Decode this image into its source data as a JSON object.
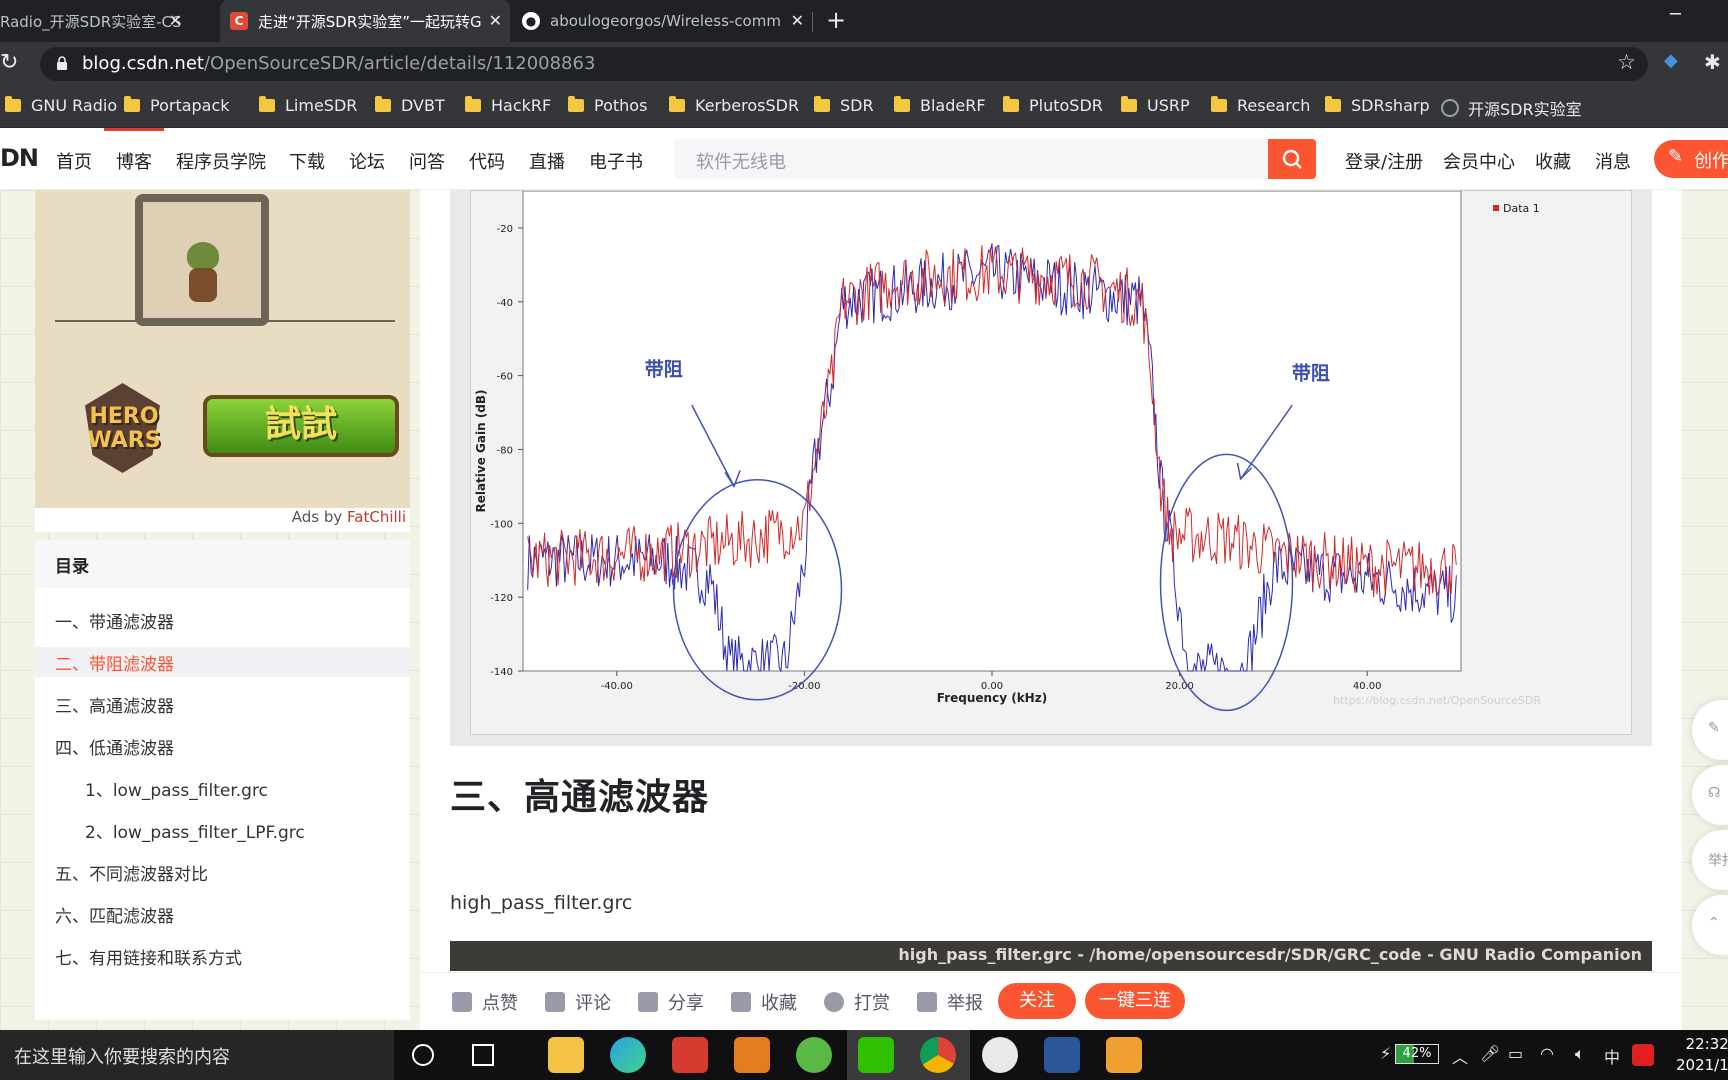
{
  "browser": {
    "tabs": [
      {
        "title": "Radio_开源SDR实验室-CS",
        "active": false,
        "favicon": "csdn-favicon"
      },
      {
        "title": "走进“开源SDR实验室”一起玩转G",
        "active": true,
        "favicon": "csdn-favicon"
      },
      {
        "title": "aboulogeorgos/Wireless-comm",
        "active": false,
        "favicon": "github-favicon"
      }
    ],
    "close_glyph": "✕",
    "new_tab_glyph": "+",
    "minimize_glyph": "─",
    "url_domain": "blog.csdn.net",
    "url_path": "/OpenSourceSDR/article/details/112008863",
    "bookmarks": [
      {
        "label": "GNU Radio",
        "icon": "folder-icon"
      },
      {
        "label": "Portapack",
        "icon": "folder-icon"
      },
      {
        "label": "LimeSDR",
        "icon": "folder-icon"
      },
      {
        "label": "DVBT",
        "icon": "folder-icon"
      },
      {
        "label": "HackRF",
        "icon": "folder-icon"
      },
      {
        "label": "Pothos",
        "icon": "folder-icon"
      },
      {
        "label": "KerberosSDR",
        "icon": "folder-icon"
      },
      {
        "label": "SDR",
        "icon": "folder-icon"
      },
      {
        "label": "BladeRF",
        "icon": "folder-icon"
      },
      {
        "label": "PlutoSDR",
        "icon": "folder-icon"
      },
      {
        "label": "USRP",
        "icon": "folder-icon"
      },
      {
        "label": "Research",
        "icon": "folder-icon"
      },
      {
        "label": "SDRsharp",
        "icon": "folder-icon"
      },
      {
        "label": "开源SDR实验室",
        "icon": "globe-icon"
      }
    ]
  },
  "csdn": {
    "logo": "DN",
    "nav": [
      "首页",
      "博客",
      "程序员学院",
      "下载",
      "论坛",
      "问答",
      "代码",
      "直播",
      "电子书"
    ],
    "search_placeholder": "软件无线电",
    "right_nav": [
      "登录/注册",
      "会员中心",
      "收藏",
      "消息"
    ],
    "create_label": "创作"
  },
  "ad": {
    "hero_text_1": "HERO",
    "hero_text_2": "WARS",
    "button_text": "試試",
    "ads_by": "Ads by ",
    "ads_brand": "FatChilli"
  },
  "toc": {
    "title": "目录",
    "items": [
      {
        "label": "一、带通滤波器",
        "level": 1,
        "active": false
      },
      {
        "label": "二、带阻滤波器",
        "level": 1,
        "active": true
      },
      {
        "label": "三、高通滤波器",
        "level": 1,
        "active": false
      },
      {
        "label": "四、低通滤波器",
        "level": 1,
        "active": false
      },
      {
        "label": "1、low_pass_filter.grc",
        "level": 2,
        "active": false
      },
      {
        "label": "2、low_pass_filter_LPF.grc",
        "level": 2,
        "active": false
      },
      {
        "label": "五、不同滤波器对比",
        "level": 1,
        "active": false
      },
      {
        "label": "六、匹配滤波器",
        "level": 1,
        "active": false
      },
      {
        "label": "七、有用链接和联系方式",
        "level": 1,
        "active": false
      }
    ]
  },
  "chart_data": {
    "type": "line",
    "title": "",
    "xlabel": "Frequency (kHz)",
    "ylabel": "Relative Gain (dB)",
    "xlim": [
      -50,
      50
    ],
    "ylim": [
      -140,
      -10
    ],
    "xticks": [
      -40,
      -20,
      0,
      20,
      40
    ],
    "xtick_labels": [
      "-40.00",
      "-20.00",
      "0.00",
      "20.00",
      "40.00"
    ],
    "yticks": [
      -20,
      -40,
      -60,
      -80,
      -100,
      -120,
      -140
    ],
    "legend": {
      "entries": [
        "Data 1"
      ],
      "position": "top-right"
    },
    "series": [
      {
        "name": "Data 1",
        "color": "#d12a2a",
        "envelope": [
          [
            -50,
            -110
          ],
          [
            -35,
            -108
          ],
          [
            -30,
            -106
          ],
          [
            -25,
            -104
          ],
          [
            -20,
            -100
          ],
          [
            -19,
            -85
          ],
          [
            -17,
            -60
          ],
          [
            -16,
            -40
          ],
          [
            -10,
            -34
          ],
          [
            0,
            -32
          ],
          [
            10,
            -34
          ],
          [
            16,
            -40
          ],
          [
            17,
            -60
          ],
          [
            18,
            -90
          ],
          [
            19,
            -103
          ],
          [
            25,
            -104
          ],
          [
            30,
            -108
          ],
          [
            40,
            -112
          ],
          [
            50,
            -112
          ]
        ]
      },
      {
        "color": "#2a2ab4",
        "envelope": [
          [
            -50,
            -110
          ],
          [
            -35,
            -110
          ],
          [
            -30,
            -115
          ],
          [
            -28,
            -138
          ],
          [
            -22,
            -138
          ],
          [
            -20,
            -110
          ],
          [
            -19,
            -85
          ],
          [
            -17,
            -60
          ],
          [
            -16,
            -40
          ],
          [
            0,
            -32
          ],
          [
            16,
            -40
          ],
          [
            17,
            -60
          ],
          [
            18,
            -90
          ],
          [
            19,
            -105
          ],
          [
            21,
            -140
          ],
          [
            27,
            -140
          ],
          [
            30,
            -112
          ],
          [
            40,
            -115
          ],
          [
            50,
            -120
          ]
        ]
      }
    ],
    "annotations": [
      {
        "text": "带阻",
        "x": -35,
        "y": -60
      },
      {
        "text": "带阻",
        "x": 34,
        "y": -61
      }
    ],
    "watermark": "https://blog.csdn.net/OpenSourceSDR"
  },
  "article": {
    "heading": "三、高通滤波器",
    "paragraph": "high_pass_filter.grc",
    "window_title": "high_pass_filter.grc - /home/opensourcesdr/SDR/GRC_code - GNU Radio Companion"
  },
  "actions": {
    "like": "点赞",
    "comment": "评论",
    "share": "分享",
    "collect": "收藏",
    "reward": "打赏",
    "report": "举报",
    "follow": "关注",
    "triple": "一键三连"
  },
  "side_widgets": {
    "report_label": "举报"
  },
  "taskbar": {
    "search_placeholder": "在这里输入你要搜索的内容",
    "battery": "42%",
    "battery_level": 0.42,
    "ime": "中",
    "time": "22:32",
    "date": "2021/1"
  }
}
